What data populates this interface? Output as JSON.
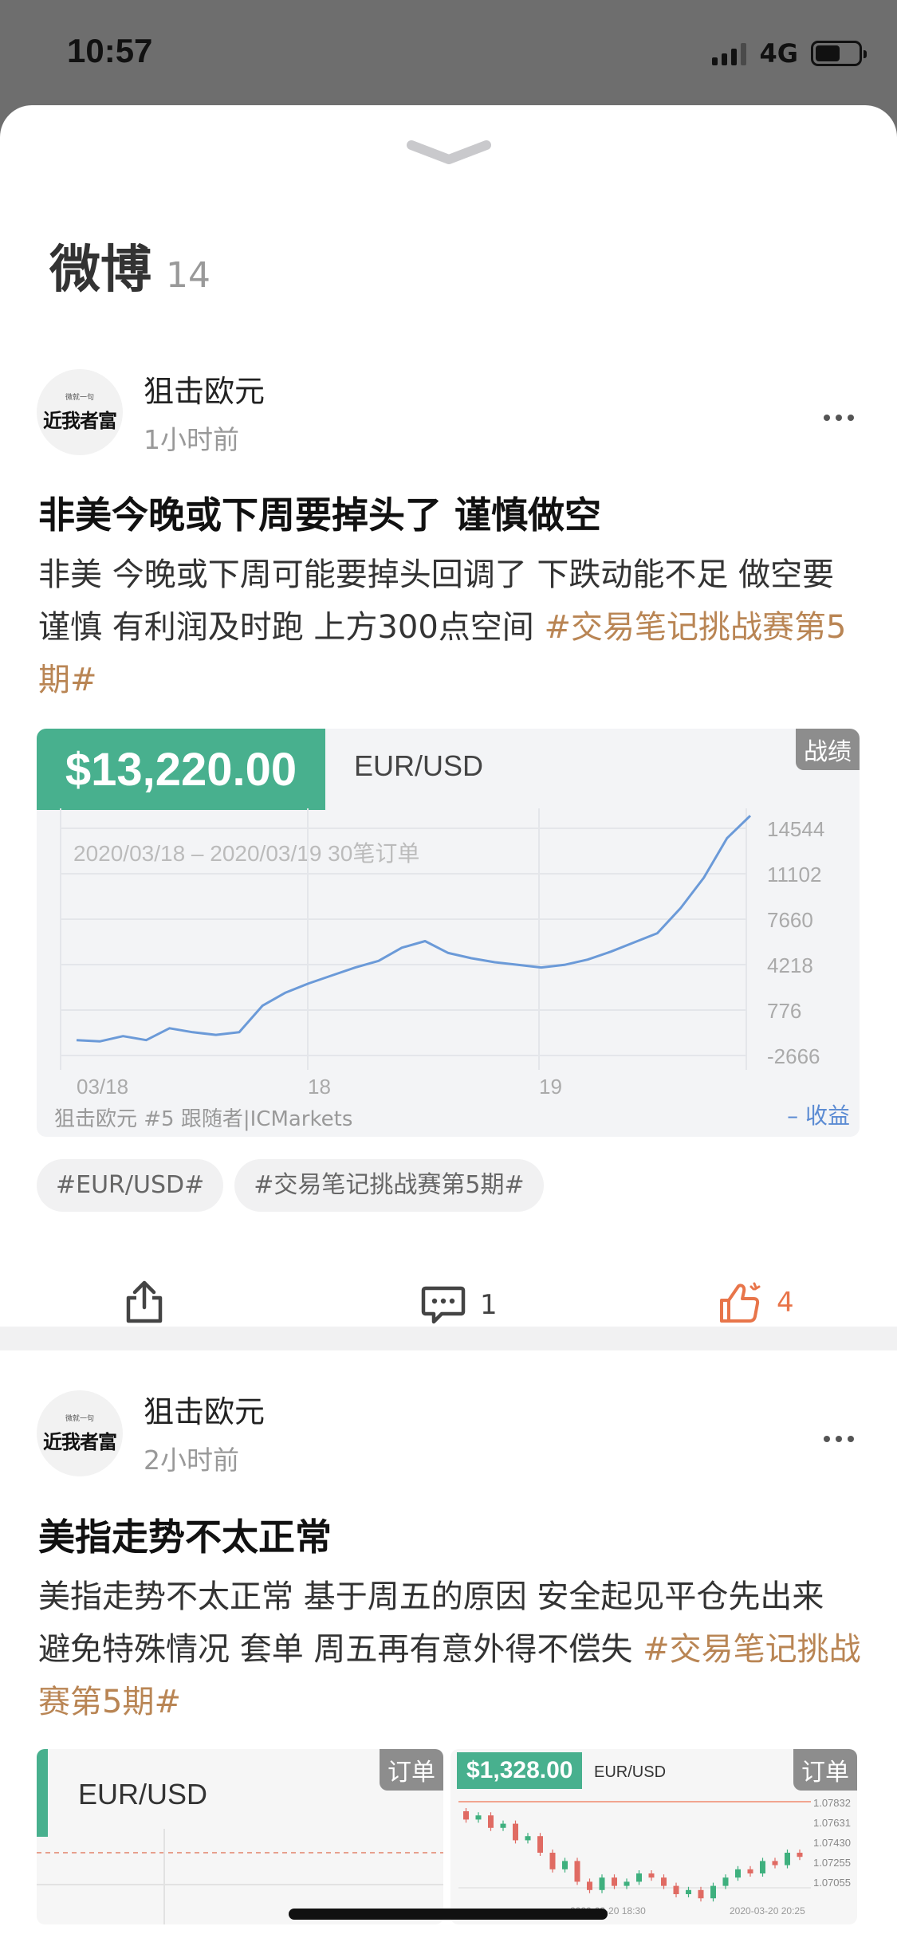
{
  "status": {
    "time": "10:57",
    "network": "4G"
  },
  "sheet": {
    "title": "微博",
    "count": "14"
  },
  "posts": [
    {
      "avatar_small": "微就一句",
      "avatar_big": "近我者富",
      "author": "狙击欧元",
      "time": "1小时前",
      "title": "非美今晚或下周要掉头了 谨慎做空",
      "body": "非美 今晚或下周可能要掉头回调了 下跌动能不足 做空要谨慎 有利润及时跑 上方300点空间 ",
      "body_tag": "#交易笔记挑战赛第5期#",
      "card": {
        "profit": "$13,220.00",
        "pair": "EUR/USD",
        "badge": "战绩",
        "range": "2020/03/18 – 2020/03/19 30笔订单",
        "footer": "狙击欧元 #5 跟随者|ICMarkets",
        "legend": "收益"
      },
      "chips": [
        "#EUR/USD#",
        "#交易笔记挑战赛第5期#"
      ],
      "comments": "1",
      "likes": "4"
    },
    {
      "avatar_small": "微就一句",
      "avatar_big": "近我者富",
      "author": "狙击欧元",
      "time": "2小时前",
      "title": "美指走势不太正常",
      "body": "美指走势不太正常 基于周五的原因 安全起见平仓先出来 避免特殊情况 套单 周五再有意外得不偿失 ",
      "body_tag": "#交易笔记挑战赛第5期#",
      "mini1": {
        "pair": "EUR/USD",
        "badge": "订单"
      },
      "mini2": {
        "profit": "$1,328.00",
        "pair": "EUR/USD",
        "badge": "订单",
        "prices": [
          "1.07832",
          "1.07631",
          "1.07430",
          "1.07255",
          "1.07055"
        ],
        "time_labels": [
          "2020-03-20 18:30",
          "2020-03-20 20:25"
        ]
      }
    }
  ],
  "chart_data": {
    "type": "line",
    "title": "",
    "xlabel": "",
    "ylabel": "",
    "x_tick_labels": [
      "03/18",
      "18",
      "19"
    ],
    "y_tick_labels": [
      "14544",
      "11102",
      "7660",
      "4218",
      "776",
      "-2666"
    ],
    "ylim": [
      -2666,
      14544
    ],
    "grid": true,
    "legend": "bottom-right",
    "series": [
      {
        "name": "收益",
        "color": "#6b9ad8",
        "values": [
          0,
          -100,
          300,
          0,
          900,
          600,
          400,
          600,
          2600,
          3600,
          4300,
          4900,
          5500,
          6000,
          7000,
          7500,
          6600,
          6200,
          5900,
          5700,
          5500,
          5700,
          6100,
          6700,
          7400,
          8100,
          10000,
          12300,
          15300,
          17000
        ]
      }
    ]
  }
}
